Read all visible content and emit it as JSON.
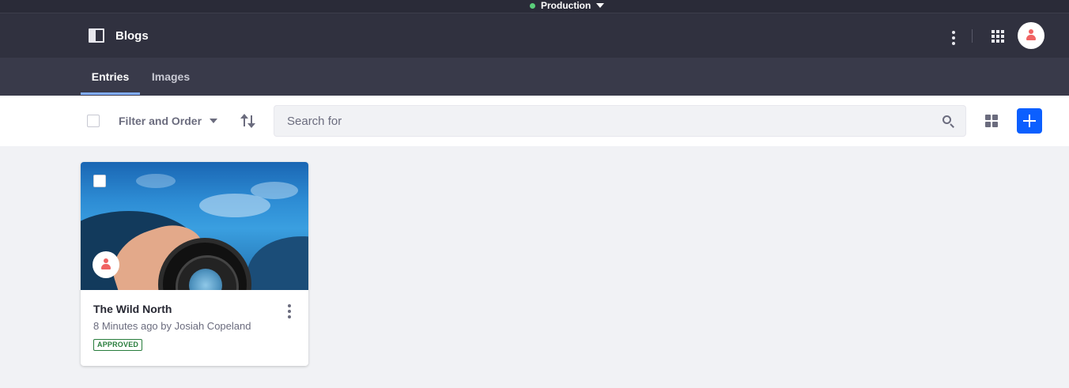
{
  "environment": {
    "label": "Production",
    "status_color": "#5ace7a"
  },
  "app_bar": {
    "title": "Blogs",
    "icons": [
      "sidebar-panel-icon",
      "options-kebab-icon",
      "apps-grid-icon",
      "user-avatar-icon"
    ]
  },
  "tabs": [
    {
      "label": "Entries",
      "active": true
    },
    {
      "label": "Images",
      "active": false
    }
  ],
  "toolbar": {
    "filter_label": "Filter and Order",
    "search_placeholder": "Search for",
    "search_value": "",
    "icons": [
      "select-all-checkbox",
      "sort-arrows-icon",
      "search-icon",
      "cards-view-icon",
      "plus-icon"
    ]
  },
  "entries": [
    {
      "title": "The Wild North",
      "meta": "8 Minutes ago by Josiah Copeland",
      "status": "APPROVED",
      "status_color": "#287d3c",
      "selected": false
    }
  ],
  "colors": {
    "accent": "#0b5fff",
    "tab_indicator": "#80acff",
    "header_bg": "#30313f",
    "avatar_icon": "#f06363"
  }
}
